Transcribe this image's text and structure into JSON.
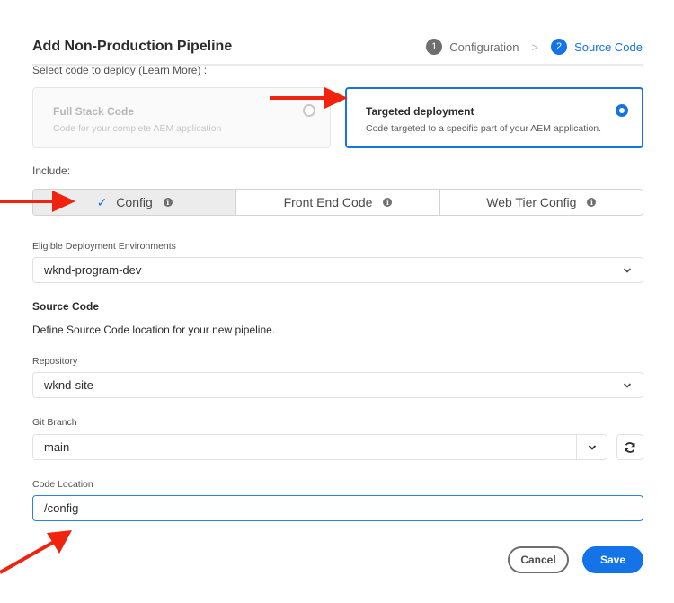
{
  "dialog": {
    "title": "Add Non-Production Pipeline",
    "stepper": [
      {
        "number": "1",
        "label": "Configuration",
        "state": "done"
      },
      {
        "number": "2",
        "label": "Source Code",
        "state": "active"
      }
    ],
    "step_separator": ">"
  },
  "code_selection": {
    "prompt_prefix": "Select code to deploy (",
    "learn_more": "Learn More",
    "prompt_suffix": ") :",
    "options": [
      {
        "title": "Full Stack Code",
        "description": "Code for your complete AEM application",
        "selected": false,
        "disabled": true
      },
      {
        "title": "Targeted deployment",
        "description": "Code targeted to a specific part of your AEM application.",
        "selected": true,
        "disabled": false
      }
    ]
  },
  "include": {
    "label": "Include:",
    "options": [
      {
        "label": "Config",
        "selected": true
      },
      {
        "label": "Front End Code",
        "selected": false
      },
      {
        "label": "Web Tier Config",
        "selected": false
      }
    ],
    "check_glyph": "✓",
    "info_glyph": "i"
  },
  "environment": {
    "label": "Eligible Deployment Environments",
    "value": "wknd-program-dev"
  },
  "source_code": {
    "title": "Source Code",
    "description": "Define Source Code location for your new pipeline.",
    "repository": {
      "label": "Repository",
      "value": "wknd-site"
    },
    "git_branch": {
      "label": "Git Branch",
      "value": "main"
    },
    "code_location": {
      "label": "Code Location",
      "value": "/config"
    }
  },
  "footer": {
    "cancel_label": "Cancel",
    "save_label": "Save"
  },
  "colors": {
    "accent": "#1473e6",
    "annotation_arrow": "#f0230f"
  }
}
